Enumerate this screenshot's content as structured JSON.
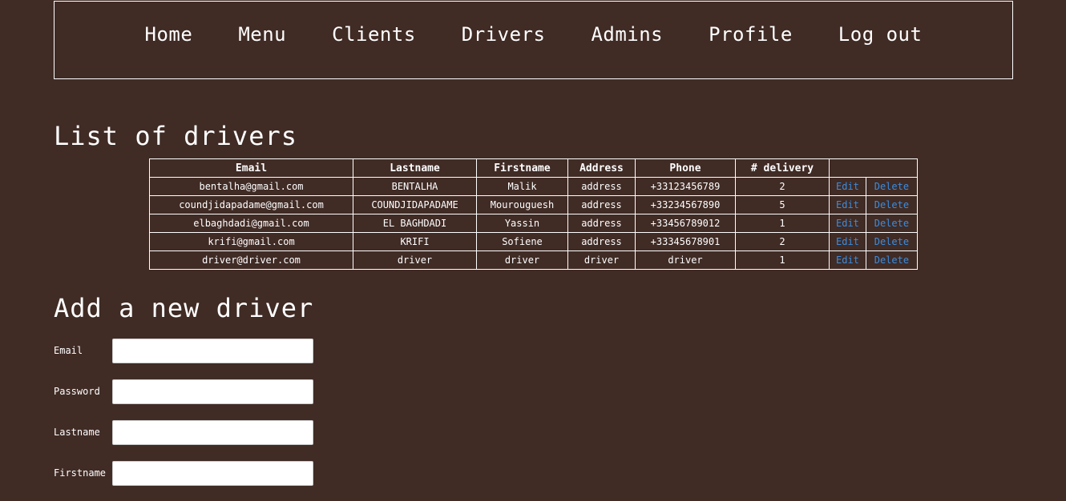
{
  "nav": {
    "items": [
      {
        "label": "Home"
      },
      {
        "label": "Menu"
      },
      {
        "label": "Clients"
      },
      {
        "label": "Drivers"
      },
      {
        "label": "Admins"
      },
      {
        "label": "Profile"
      },
      {
        "label": "Log out"
      }
    ]
  },
  "list_section": {
    "title": "List of drivers"
  },
  "table": {
    "headers": [
      "Email",
      "Lastname",
      "Firstname",
      "Address",
      "Phone",
      "# delivery",
      ""
    ],
    "edit_label": "Edit",
    "delete_label": "Delete",
    "rows": [
      {
        "email": "bentalha@gmail.com",
        "lastname": "BENTALHA",
        "firstname": "Malik",
        "address": "address",
        "phone": "+33123456789",
        "delivery": "2"
      },
      {
        "email": "coundjidapadame@gmail.com",
        "lastname": "COUNDJIDAPADAME",
        "firstname": "Mourouguesh",
        "address": "address",
        "phone": "+33234567890",
        "delivery": "5"
      },
      {
        "email": "elbaghdadi@gmail.com",
        "lastname": "EL BAGHDADI",
        "firstname": "Yassin",
        "address": "address",
        "phone": "+33456789012",
        "delivery": "1"
      },
      {
        "email": "krifi@gmail.com",
        "lastname": "KRIFI",
        "firstname": "Sofiene",
        "address": "address",
        "phone": "+33345678901",
        "delivery": "2"
      },
      {
        "email": "driver@driver.com",
        "lastname": "driver",
        "firstname": "driver",
        "address": "driver",
        "phone": "driver",
        "delivery": "1"
      }
    ]
  },
  "form": {
    "title": "Add a new driver",
    "fields": [
      {
        "label": "Email",
        "value": "",
        "placeholder": ""
      },
      {
        "label": "Password",
        "value": "",
        "placeholder": ""
      },
      {
        "label": "Lastname",
        "value": "",
        "placeholder": ""
      },
      {
        "label": "Firstname",
        "value": "",
        "placeholder": ""
      }
    ]
  },
  "colors": {
    "background": "#402b25",
    "text": "#ffffff",
    "link": "#3a8de0"
  }
}
